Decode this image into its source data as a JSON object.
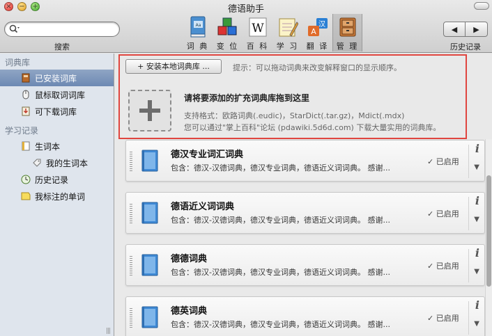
{
  "window": {
    "title": "德语助手"
  },
  "search": {
    "value": "",
    "placeholder": "",
    "label": "搜索"
  },
  "toolbar": {
    "tools": [
      {
        "label": "词 典",
        "icon": "dictionary-icon"
      },
      {
        "label": "变 位",
        "icon": "conjugation-cubes-icon"
      },
      {
        "label": "百 科",
        "icon": "wikipedia-icon"
      },
      {
        "label": "学 习",
        "icon": "study-notebook-icon"
      },
      {
        "label": "翻 译",
        "icon": "translate-icon"
      },
      {
        "label": "管 理",
        "icon": "manage-cabinet-icon"
      }
    ],
    "active_tool": "管 理",
    "history_back": "◀",
    "history_forward": "▶",
    "history_label": "历史记录"
  },
  "sidebar": {
    "section1": "词典库",
    "items1": [
      {
        "label": "已安装词库",
        "icon": "book-icon",
        "selected": true
      },
      {
        "label": "鼠标取词词库",
        "icon": "mouse-icon"
      },
      {
        "label": "可下载词库",
        "icon": "download-icon"
      }
    ],
    "section2": "学习记录",
    "items2": [
      {
        "label": "生词本",
        "icon": "notebook-icon"
      },
      {
        "label": "我的生词本",
        "icon": "tag-icon"
      },
      {
        "label": "历史记录",
        "icon": "clock-icon"
      },
      {
        "label": "我标注的单词",
        "icon": "note-icon"
      }
    ]
  },
  "main": {
    "install_button": "安装本地词典库 ...",
    "install_plus": "+",
    "hint": "提示：可以拖动词典来改变解释窗口的显示顺序。",
    "drop_title": "请将要添加的扩充词典库拖到这里",
    "drop_formats": "支持格式：欧路词典(.eudic)，StarDict(.tar.gz)，Mdict(.mdx)",
    "drop_download": "您可以通过\"掌上百科\"论坛 (pdawiki.5d6d.com) 下载大量实用的词典库。",
    "dictionaries": [
      {
        "name": "德汉专业词汇词典",
        "desc": "包含：德汉-汉德词典，德汉专业词典，德语近义词词典。 感谢...",
        "status": "✓ 已启用"
      },
      {
        "name": "德语近义词词典",
        "desc": "包含：德汉-汉德词典，德汉专业词典，德语近义词词典。 感谢...",
        "status": "✓ 已启用"
      },
      {
        "name": "德德词典",
        "desc": "包含：德汉-汉德词典，德汉专业词典，德语近义词词典。 感谢...",
        "status": "✓ 已启用"
      },
      {
        "name": "德英词典",
        "desc": "包含：德汉-汉德词典，德汉专业词典，德语近义词词典。 感谢...",
        "status": "✓ 已启用"
      }
    ],
    "info_glyph": "i",
    "menu_glyph": "▼"
  },
  "colors": {
    "highlight_frame": "#e0453f",
    "sidebar_bg": "#dfe5ed",
    "selection": "#7d95ba"
  }
}
